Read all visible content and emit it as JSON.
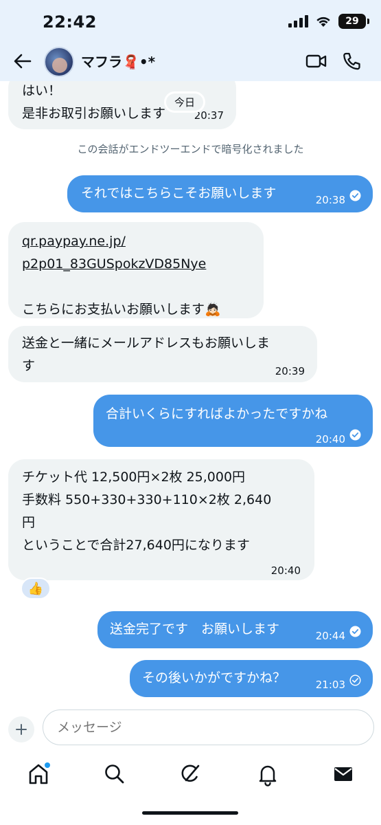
{
  "status_bar": {
    "time": "22:42",
    "battery": "29"
  },
  "header": {
    "contact_name": "マフラ🧣•*"
  },
  "chat": {
    "date_chip": "今日",
    "system_message": "この会話がエンドツーエンドで暗号化されました",
    "messages": [
      {
        "direction": "in",
        "lines": [
          "はい！",
          "是非お取引お願いします"
        ],
        "time": "20:37"
      },
      {
        "direction": "out",
        "text": "それではこちらこそお願いします",
        "time": "20:38"
      },
      {
        "direction": "in",
        "link_lines": [
          "qr.paypay.ne.jp/",
          "p2p01_83GUSpokzVD85Nye"
        ],
        "text": "こちらにお支払いお願いします🙇🏻"
      },
      {
        "direction": "in",
        "lines": [
          "送金と一緒にメールアドレスもお願いしま",
          "す"
        ],
        "time": "20:39"
      },
      {
        "direction": "out",
        "text": "合計いくらにすればよかったですかね",
        "time": "20:40"
      },
      {
        "direction": "in",
        "lines": [
          "チケット代 12,500円×2枚 25,000円",
          "手数料 550+330+330+110×2枚 2,640",
          "円",
          "ということで合計27,640円になります"
        ],
        "time": "20:40",
        "reaction": "👍"
      },
      {
        "direction": "out",
        "text": "送金完了です　お願いします",
        "time": "20:44"
      },
      {
        "direction": "out",
        "text": "その後いかがですかね？",
        "time": "21:03"
      }
    ]
  },
  "composer": {
    "placeholder": "メッセージ"
  },
  "colors": {
    "accent": "#1d9bf0",
    "outgoing_bubble": "#4696e8",
    "incoming_bubble": "#eff3f4",
    "header_tint": "#e8f2fc"
  },
  "icons": {
    "header": [
      "back-arrow-icon",
      "video-call-icon",
      "phone-icon"
    ],
    "nav": [
      "home-icon",
      "search-icon",
      "grok-icon",
      "notifications-icon",
      "messages-icon"
    ]
  }
}
